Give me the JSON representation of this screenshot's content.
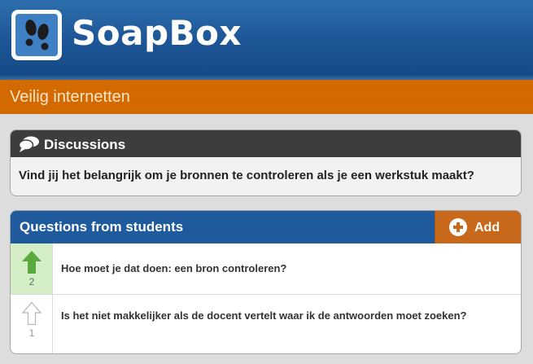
{
  "app": {
    "name": "SoapBox",
    "logo_icon": "footprints-icon"
  },
  "section": {
    "title": "Veilig internetten"
  },
  "discussions": {
    "title": "Discussions",
    "icon": "speech-bubbles-icon",
    "question": "Vind jij het belangrijk om je bronnen te controleren als je een werkstuk maakt?"
  },
  "questions": {
    "title": "Questions from students",
    "add_label": "Add",
    "add_icon": "plus-circle-icon",
    "items": [
      {
        "text": "Hoe moet je dat doen: een bron controleren?",
        "votes": "2",
        "voted": true,
        "vote_icon": "upvote-arrow-icon"
      },
      {
        "text": "Is het niet makkelijker als de docent vertelt waar ik de antwoorden moet zoeken?",
        "votes": "1",
        "voted": false,
        "vote_icon": "upvote-arrow-icon"
      }
    ]
  },
  "colors": {
    "header_blue": "#1d5596",
    "section_orange": "#d36a00",
    "add_orange": "#c8681a",
    "vote_green": "#5aa93f"
  }
}
